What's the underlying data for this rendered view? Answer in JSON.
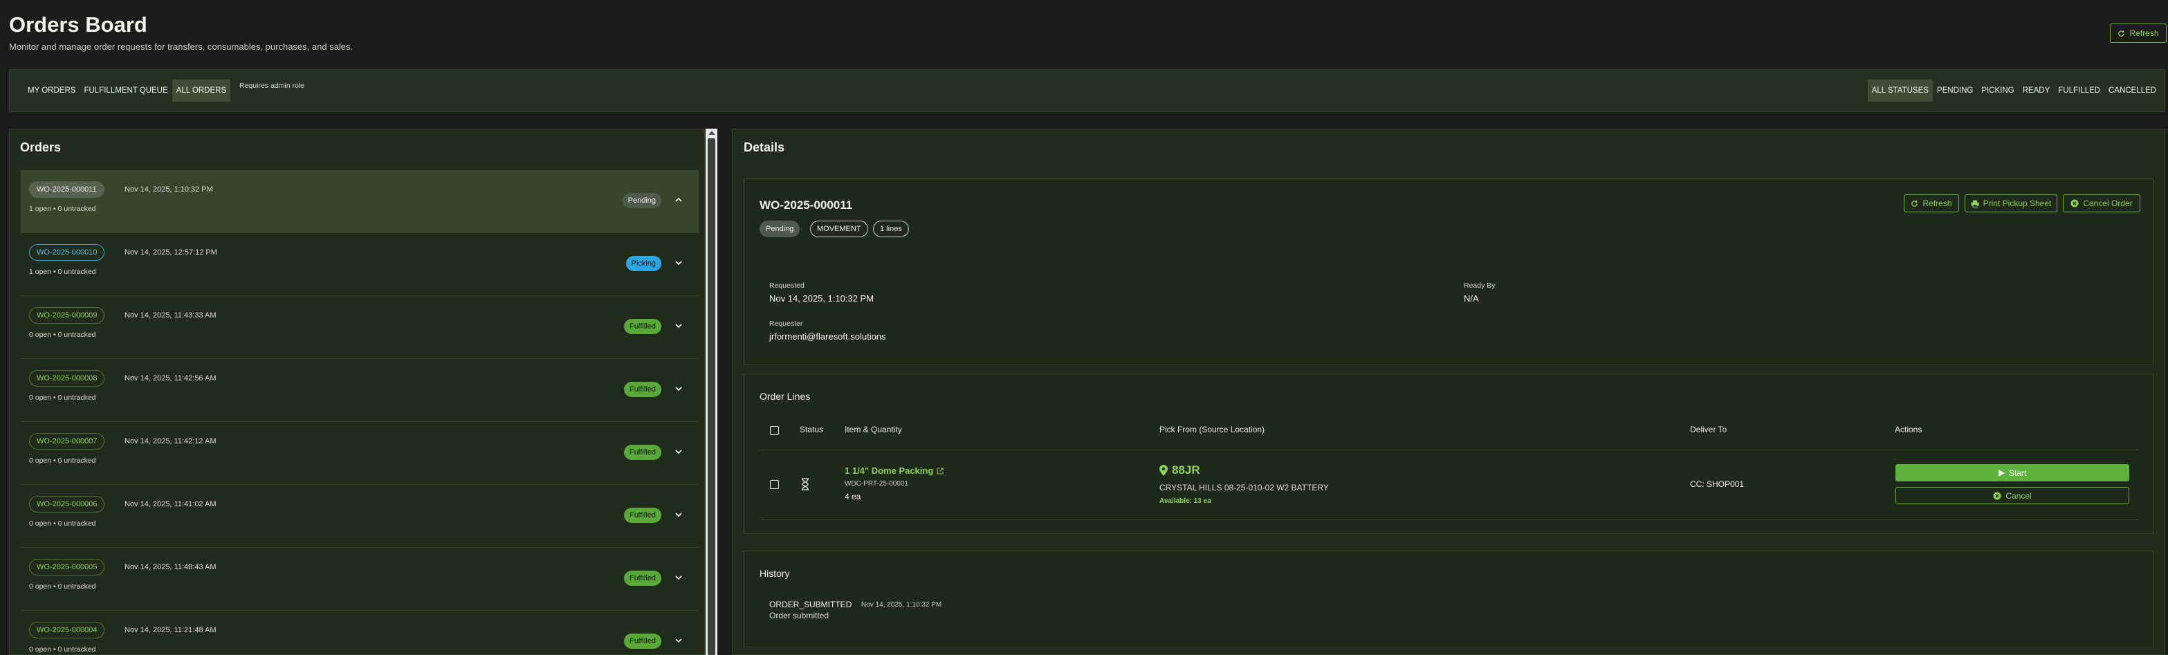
{
  "header": {
    "title": "Orders Board",
    "subtitle": "Monitor and manage order requests for transfers, consumables, purchases, and sales.",
    "refresh_label": "Refresh"
  },
  "view_tabs": [
    {
      "label": "MY ORDERS",
      "active": false
    },
    {
      "label": "FULFILLMENT QUEUE",
      "active": false
    },
    {
      "label": "ALL ORDERS",
      "active": true
    }
  ],
  "admin_note": "Requires admin role",
  "status_filters": [
    {
      "label": "ALL STATUSES",
      "active": true
    },
    {
      "label": "PENDING",
      "active": false
    },
    {
      "label": "PICKING",
      "active": false
    },
    {
      "label": "READY",
      "active": false
    },
    {
      "label": "FULFILLED",
      "active": false
    },
    {
      "label": "CANCELLED",
      "active": false
    }
  ],
  "orders_panel": {
    "title": "Orders",
    "orders": [
      {
        "id": "WO-2025-000011",
        "date": "Nov 14, 2025, 1:10:32 PM",
        "sub": "1 open • 0 untracked",
        "status": "Pending",
        "selected": true
      },
      {
        "id": "WO-2025-000010",
        "date": "Nov 14, 2025, 12:57:12 PM",
        "sub": "1 open • 0 untracked",
        "status": "Picking",
        "selected": false
      },
      {
        "id": "WO-2025-000009",
        "date": "Nov 14, 2025, 11:43:33 AM",
        "sub": "0 open • 0 untracked",
        "status": "Fulfilled",
        "selected": false
      },
      {
        "id": "WO-2025-000008",
        "date": "Nov 14, 2025, 11:42:56 AM",
        "sub": "0 open • 0 untracked",
        "status": "Fulfilled",
        "selected": false
      },
      {
        "id": "WO-2025-000007",
        "date": "Nov 14, 2025, 11:42:12 AM",
        "sub": "0 open • 0 untracked",
        "status": "Fulfilled",
        "selected": false
      },
      {
        "id": "WO-2025-000006",
        "date": "Nov 14, 2025, 11:41:02 AM",
        "sub": "0 open • 0 untracked",
        "status": "Fulfilled",
        "selected": false
      },
      {
        "id": "WO-2025-000005",
        "date": "Nov 14, 2025, 11:48:43 AM",
        "sub": "0 open • 0 untracked",
        "status": "Fulfilled",
        "selected": false
      },
      {
        "id": "WO-2025-000004",
        "date": "Nov 14, 2025, 11:21:48 AM",
        "sub": "0 open • 0 untracked",
        "status": "Fulfilled",
        "selected": false
      }
    ]
  },
  "details": {
    "title": "Details",
    "order_id": "WO-2025-000011",
    "status": "Pending",
    "type": "MOVEMENT",
    "lines_count": "1 lines",
    "actions": {
      "refresh": "Refresh",
      "print": "Print Pickup Sheet",
      "cancel": "Cancel Order"
    },
    "requested_label": "Requested",
    "requested_value": "Nov 14, 2025, 1:10:32 PM",
    "ready_by_label": "Ready By",
    "ready_by_value": "N/A",
    "requester_label": "Requester",
    "requester_value": "jrformenti@flaresoft.solutions"
  },
  "order_lines": {
    "title": "Order Lines",
    "columns": [
      "Status",
      "Item & Quantity",
      "Pick From (Source Location)",
      "Deliver To",
      "Actions"
    ],
    "rows": [
      {
        "item_name": "1 1/4\" Dome Packing",
        "item_code": "WDC-PRT-25-00001",
        "quantity": "4 ea",
        "location_code": "88JR",
        "location_name": "CRYSTAL HILLS 08-25-010-02 W2 BATTERY",
        "available": "Available: 13 ea",
        "deliver_to": "CC: SHOP001",
        "start_label": "Start",
        "cancel_label": "Cancel"
      }
    ]
  },
  "history": {
    "title": "History",
    "events": [
      {
        "event": "ORDER_SUBMITTED",
        "date": "Nov 14, 2025, 1:10:32 PM",
        "note": "Order submitted"
      }
    ]
  },
  "colors": {
    "accent": "#5fb13d",
    "picking": "#2aa7e0",
    "background": "#1b1d1b",
    "panel": "#212b1c"
  }
}
